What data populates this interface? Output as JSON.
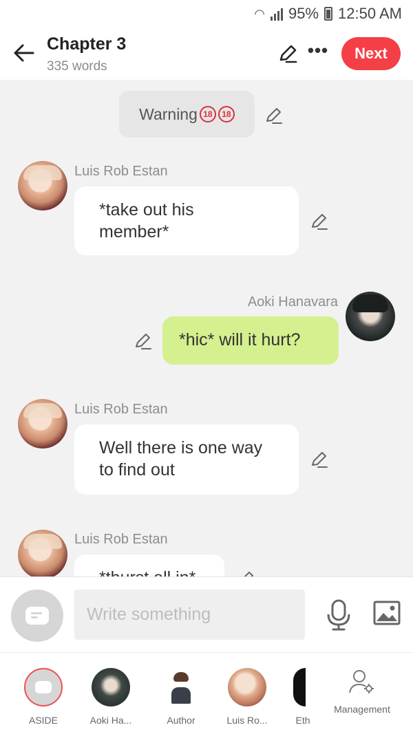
{
  "status_bar": {
    "battery": "95%",
    "time": "12:50 AM"
  },
  "header": {
    "title": "Chapter 3",
    "subtitle": "335 words",
    "next_label": "Next"
  },
  "chat": {
    "warning": {
      "text": "Warning",
      "badges": [
        "18",
        "18"
      ]
    },
    "messages": [
      {
        "speaker": "Luis Rob Estan",
        "side": "left",
        "lines": [
          "*take out his",
          "member*"
        ]
      },
      {
        "speaker": "Aoki Hanavara",
        "side": "right",
        "lines": [
          "*hic* will it hurt?"
        ]
      },
      {
        "speaker": "Luis Rob Estan",
        "side": "left",
        "lines": [
          "Well there is one way",
          "to find out"
        ]
      },
      {
        "speaker": "Luis Rob Estan",
        "side": "left",
        "lines": [
          "*thurst all in*"
        ]
      }
    ]
  },
  "composer": {
    "placeholder": "Write something"
  },
  "characters": [
    {
      "label": "ASIDE",
      "selected": true
    },
    {
      "label": "Aoki Ha...",
      "selected": false
    },
    {
      "label": "Author",
      "selected": false
    },
    {
      "label": "Luis Ro...",
      "selected": false
    },
    {
      "label": "Eth",
      "selected": false
    }
  ],
  "management_label": "Management",
  "colors": {
    "accent": "#f53f46",
    "my_bubble": "#d4f08f",
    "background": "#f2f2f2"
  }
}
